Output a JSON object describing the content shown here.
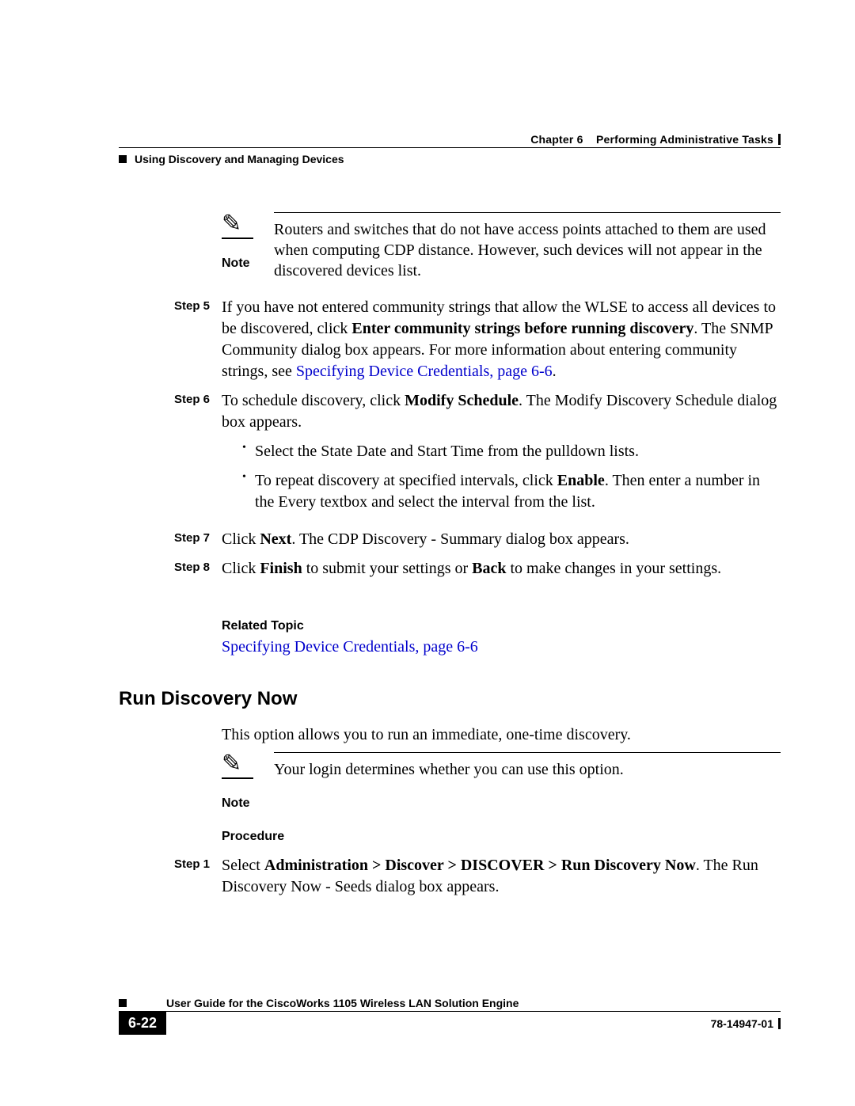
{
  "header": {
    "chapter_label": "Chapter 6",
    "chapter_title": "Performing Administrative Tasks",
    "section_title": "Using Discovery and Managing Devices"
  },
  "note1": {
    "label": "Note",
    "text": "Routers and switches that do not have access points attached to them are used when computing CDP distance. However, such devices will not appear in the discovered devices list."
  },
  "steps_a": [
    {
      "label": "Step 5",
      "pre": "If you have not entered community strings that allow the WLSE to access all devices to be discovered, click ",
      "bold1": "Enter community strings before running discovery",
      "mid": ". The SNMP Community dialog box appears. For more information about entering community strings, see ",
      "link": "Specifying Device Credentials, page 6-6",
      "post": "."
    },
    {
      "label": "Step 6",
      "pre": "To schedule discovery, click ",
      "bold1": "Modify Schedule",
      "mid": ". The Modify Discovery Schedule dialog box appears.",
      "bullets": [
        "Select the State Date and Start Time from the pulldown lists.",
        {
          "t1": "To repeat discovery at specified intervals, click ",
          "b": "Enable",
          "t2": ". Then enter a number in the Every textbox and select the interval from the list."
        }
      ]
    },
    {
      "label": "Step 7",
      "pre": "Click ",
      "bold1": "Next",
      "mid": ". The CDP Discovery - Summary dialog box appears."
    },
    {
      "label": "Step 8",
      "pre": "Click ",
      "bold1": "Finish",
      "mid": " to submit your settings or ",
      "bold2": "Back",
      "post": " to make changes in your settings."
    }
  ],
  "related": {
    "heading": "Related Topic",
    "link": "Specifying Device Credentials, page 6-6"
  },
  "h2": "Run Discovery Now",
  "intro_para": "This option allows you to run an immediate, one-time discovery.",
  "note2": {
    "label": "Note",
    "text": "Your login determines whether you can use this option."
  },
  "procedure_heading": "Procedure",
  "steps_b": [
    {
      "label": "Step 1",
      "pre": "Select ",
      "bold1": "Administration > Discover > DISCOVER > Run Discovery Now",
      "mid": ". The Run Discovery Now - Seeds dialog box appears."
    }
  ],
  "footer": {
    "guide": "User Guide for the CiscoWorks 1105 Wireless LAN Solution Engine",
    "page": "6-22",
    "docid": "78-14947-01"
  }
}
